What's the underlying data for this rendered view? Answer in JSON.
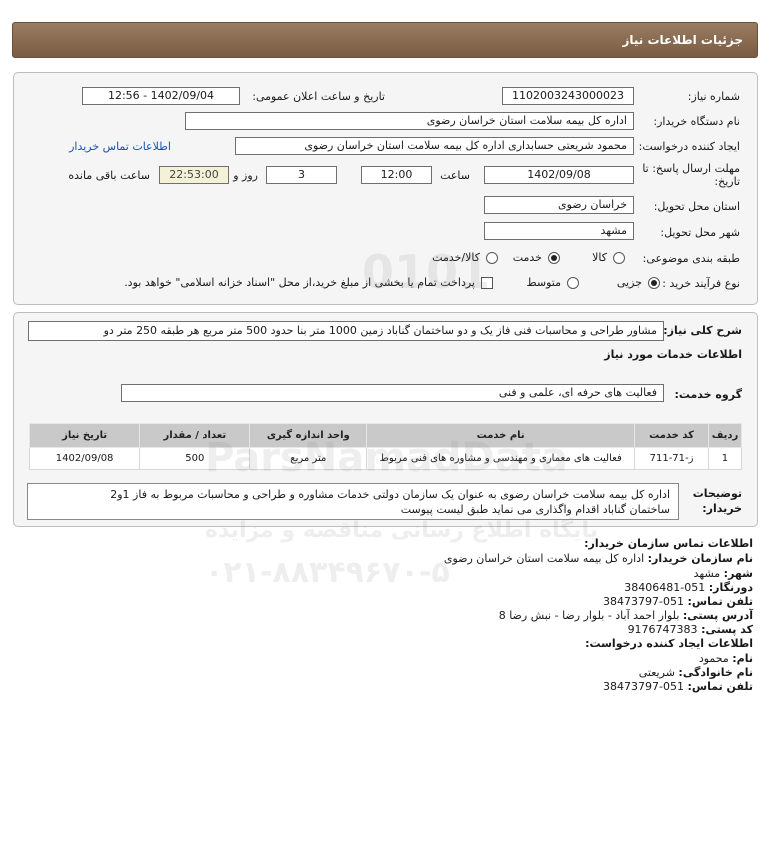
{
  "header": {
    "title": "جزئیات اطلاعات نیاز"
  },
  "form": {
    "need_number_label": "شماره نیاز:",
    "need_number": "1102003243000023",
    "announce_label": "تاریخ و ساعت اعلان عمومی:",
    "announce_value": "1402/09/04 - 12:56",
    "buyer_org_label": "نام دستگاه خریدار:",
    "buyer_org": "اداره کل بیمه سلامت استان خراسان رضوی",
    "requester_label": "ایجاد کننده درخواست:",
    "requester": "محمود شریعتی حسابداری اداره کل بیمه سلامت استان خراسان رضوی",
    "buyer_contact_link": "اطلاعات تماس خریدار",
    "deadline_label_1": "مهلت ارسال پاسخ: تا",
    "deadline_label_2": "تاریخ:",
    "deadline_date": "1402/09/08",
    "time_label": "ساعت",
    "deadline_time": "12:00",
    "days": "3",
    "days_label": "روز و",
    "remaining_time": "22:53:00",
    "remaining_label": "ساعت باقی مانده",
    "province_label": "استان محل تحویل:",
    "province": "خراسان رضوی",
    "city_label": "شهر محل تحویل:",
    "city": "مشهد",
    "category_label": "طبقه بندی موضوعی:",
    "category_options": [
      "کالا",
      "خدمت",
      "کالا/خدمت"
    ],
    "category_selected": "خدمت",
    "process_label": "نوع فرآیند خرید :",
    "process_options": [
      "جزیی",
      "متوسط"
    ],
    "process_selected": "جزیی",
    "payment_note": "پرداخت تمام یا بخشی از مبلغ خرید،از محل \"اسناد خزانه اسلامی\" خواهد بود."
  },
  "items": {
    "summary_label": "شرح کلی نیاز:",
    "summary": "مشاور طراحی و محاسبات فنی فاز یک و دو ساختمان گناباد زمین 1000 متر بنا حدود 500 متر مربع هر طبقه 250 متر دو",
    "services_title": "اطلاعات خدمات مورد نیاز",
    "service_group_label": "گروه خدمت:",
    "service_group": "فعالیت های حرفه ای، علمی و فنی",
    "table": {
      "headers": [
        "ردیف",
        "کد خدمت",
        "نام خدمت",
        "واحد اندازه گیری",
        "تعداد / مقدار",
        "تاریخ نیاز"
      ],
      "rows": [
        [
          "1",
          "ز-71-711",
          "فعالیت های معماری و مهندسی و مشاوره های فنی مربوط",
          "متر مربع",
          "500",
          "1402/09/08"
        ]
      ]
    },
    "buyer_notes_label_1": "توضیحات",
    "buyer_notes_label_2": "خریدار:",
    "buyer_notes_line1": "اداره کل بیمه سلامت خراسان رضوی به عنوان یک سازمان دولتی خدمات مشاوره و طراحی و محاسبات مربوط به فاز 1و2",
    "buyer_notes_line2": "ساختمان گناباد اقدام واگذاری می نماید طبق لیست پیوست"
  },
  "contact": {
    "org_section": "اطلاعات تماس سازمان خریدار:",
    "org_name_label": "نام سازمان خریدار:",
    "org_name": "اداره کل بیمه سلامت استان خراسان رضوی",
    "city_label": "شهر:",
    "city": "مشهد",
    "fax_label": "دورنگار:",
    "fax": "051-38406481",
    "phone_label": "تلفن تماس:",
    "phone": "051-38473797",
    "address_label": "آدرس پستی:",
    "address": "بلوار احمد آباد - بلوار رضا - نبش رضا 8",
    "postal_label": "کد پستی:",
    "postal": "9176747383",
    "creator_section": "اطلاعات ایجاد کننده درخواست:",
    "first_name_label": "نام:",
    "first_name": "محمود",
    "last_name_label": "نام خانوادگی:",
    "last_name": "شریعتی",
    "creator_phone_label": "تلفن تماس:",
    "creator_phone": "051-38473797"
  },
  "watermark": {
    "digits": "0101",
    "brand": "ParsNamadData",
    "line1": "پایگاه اطلاع رسانی مناقصه و مزایده",
    "phone": "۰۲۱-۸۸۳۴۹۶۷۰-۵"
  },
  "colors": {
    "title_bar": "#8a6c52",
    "link": "#1f4fae",
    "header_cell": "#c9c9c9"
  }
}
